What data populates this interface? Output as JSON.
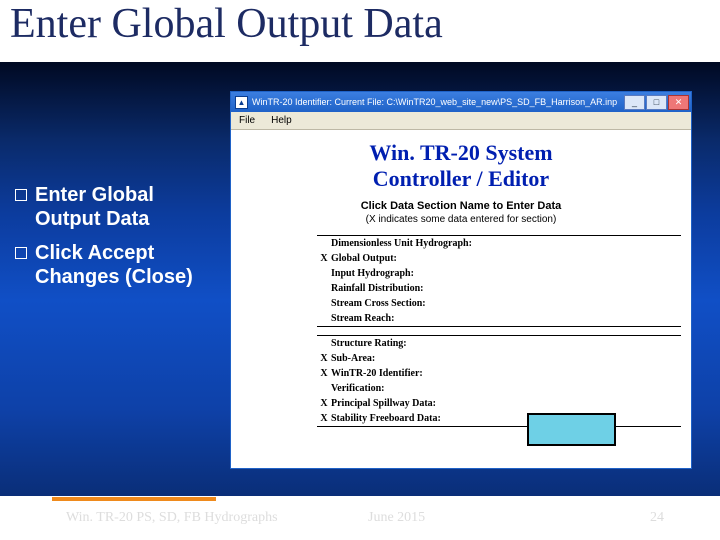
{
  "title": "Enter Global Output Data",
  "bullets": [
    "Enter Global Output Data",
    "Click Accept Changes (Close)"
  ],
  "window": {
    "title": "WinTR-20 Identifier:   Current File:   C:\\WinTR20_web_site_new\\PS_SD_FB_Harrison_AR.inp",
    "menu": [
      "File",
      "Help"
    ],
    "heading": [
      "Win. TR-20 System",
      "Controller / Editor"
    ],
    "sub1": "Click Data Section Name to Enter Data",
    "sub2": "(X indicates some data entered for section)",
    "sections": [
      {
        "x": "",
        "label": "Dimensionless Unit Hydrograph:"
      },
      {
        "x": "X",
        "label": "Global Output:"
      },
      {
        "x": "",
        "label": "Input Hydrograph:"
      },
      {
        "x": "",
        "label": "Rainfall Distribution:"
      },
      {
        "x": "",
        "label": "Stream Cross Section:"
      },
      {
        "x": "",
        "label": "Stream Reach:"
      },
      {
        "x": "",
        "label": "Structure Rating:"
      },
      {
        "x": "X",
        "label": "Sub-Area:"
      },
      {
        "x": "X",
        "label": "WinTR-20 Identifier:"
      },
      {
        "x": "",
        "label": "Verification:"
      },
      {
        "x": "X",
        "label": "Principal Spillway Data:"
      },
      {
        "x": "X",
        "label": "Stability Freeboard Data:"
      }
    ]
  },
  "footer": {
    "left": "Win. TR-20 PS, SD, FB Hydrographs",
    "center": "June 2015",
    "right": "24"
  }
}
